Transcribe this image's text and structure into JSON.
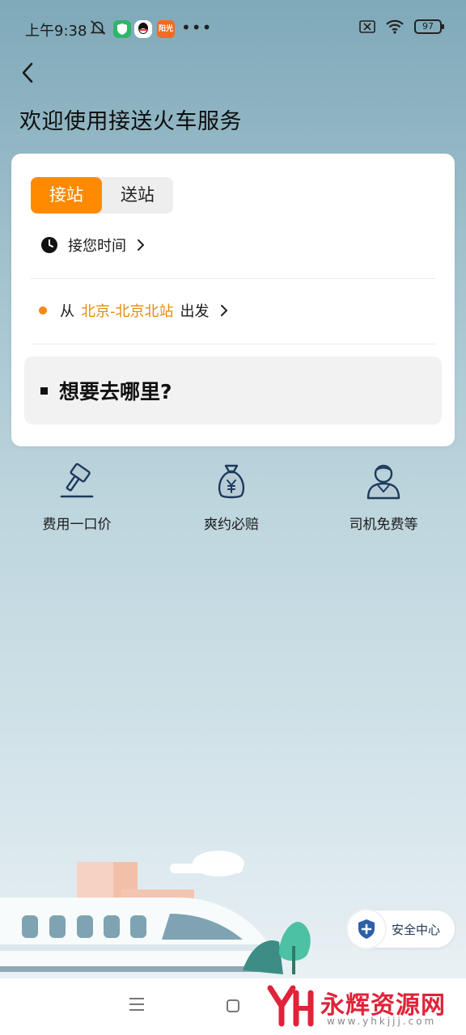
{
  "status_bar": {
    "time": "上午9:38",
    "app_badge": "阳光",
    "more": "•••",
    "battery": "97"
  },
  "header": {
    "title": "欢迎使用接送火车服务"
  },
  "service_card": {
    "tabs": [
      {
        "label": "接站",
        "active": true
      },
      {
        "label": "送站",
        "active": false
      }
    ],
    "pickup_time_label": "接您时间",
    "from_prefix": "从",
    "from_station": "北京-北京北站",
    "from_suffix": "出发",
    "destination_placeholder": "想要去哪里?"
  },
  "features": [
    {
      "label": "费用一口价",
      "icon": "gavel-icon"
    },
    {
      "label": "爽约必赔",
      "icon": "money-bag-icon"
    },
    {
      "label": "司机免费等",
      "icon": "driver-icon"
    }
  ],
  "safety_center": {
    "label": "安全中心",
    "icon": "shield-plus-icon"
  },
  "watermark": {
    "text": "永辉资源网",
    "url": "www.yhkjjj.com"
  },
  "colors": {
    "accent": "#ff8a00",
    "station": "#e68a12",
    "safety_icon": "#2e5fa8"
  }
}
